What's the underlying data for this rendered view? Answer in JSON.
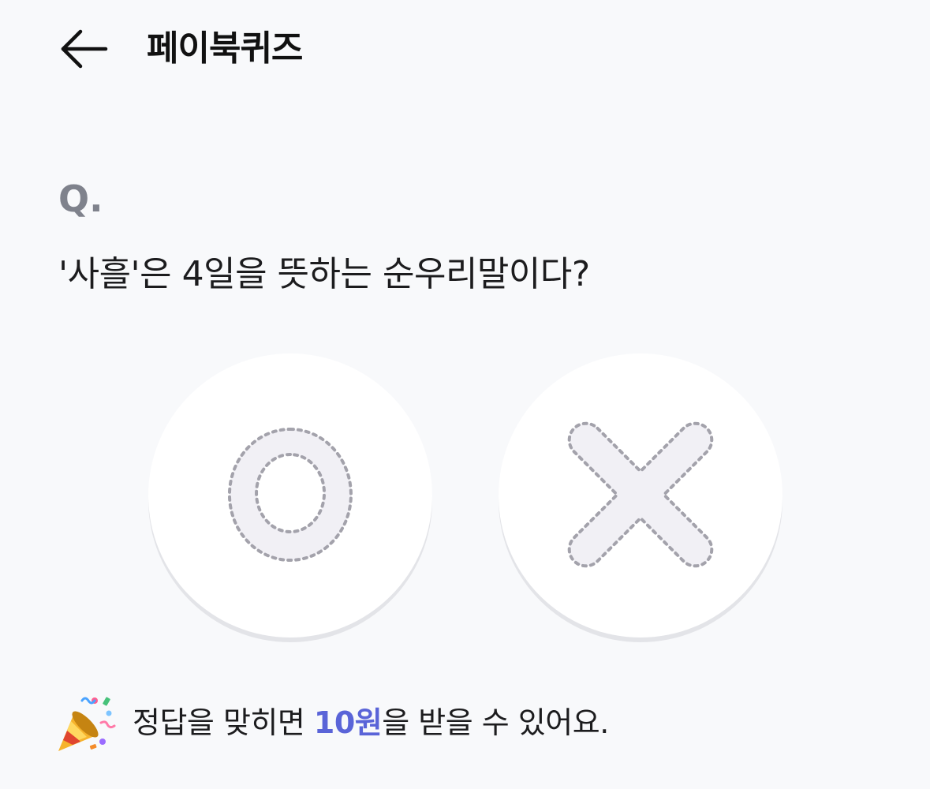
{
  "header": {
    "back_icon": "arrow-left-icon",
    "title": "페이북퀴즈"
  },
  "question": {
    "label": "Q.",
    "text": "'사흘'은 4일을 뜻하는 순우리말이다?"
  },
  "answers": [
    {
      "label": "O",
      "icon": "circle-o-icon"
    },
    {
      "label": "X",
      "icon": "cross-x-icon"
    }
  ],
  "reward": {
    "icon": "party-popper-icon",
    "prefix": "정답을 맞히면 ",
    "amount": "10원",
    "suffix": "을 받을 수 있어요."
  },
  "colors": {
    "background": "#f8f9fb",
    "accent": "#5a64d8",
    "question_label": "#7f828c",
    "symbol_fill": "#f1f0f5",
    "symbol_outline": "#a3a2ab"
  }
}
